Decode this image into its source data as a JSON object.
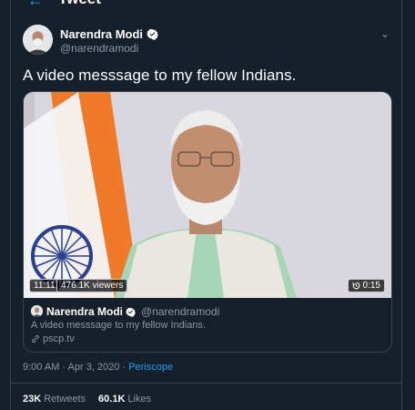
{
  "header": {
    "back_icon": "arrow-left-icon",
    "title": "Tweet"
  },
  "tweet": {
    "display_name": "Narendra Modi",
    "handle": "@narendramodi",
    "verified": true,
    "text": "A video messsage to my fellow Indians."
  },
  "video": {
    "elapsed": "11:11",
    "viewers": "476.1K viewers",
    "duration": "0:15",
    "replay_icon": "replay-icon"
  },
  "card": {
    "display_name": "Narendra Modi",
    "handle": "@narendramodi",
    "text": "A video messsage to my fellow Indians.",
    "link": "pscp.tv"
  },
  "meta": {
    "timestamp": "9:00 AM · Apr 3, 2020 · ",
    "source": "Periscope"
  },
  "stats": {
    "retweets_count": "23K",
    "retweets_label": "Retweets",
    "likes_count": "60.1K",
    "likes_label": "Likes"
  },
  "colors": {
    "background": "#15202b",
    "accent": "#1da1f2",
    "muted": "#8899a6",
    "border": "#38444d"
  }
}
